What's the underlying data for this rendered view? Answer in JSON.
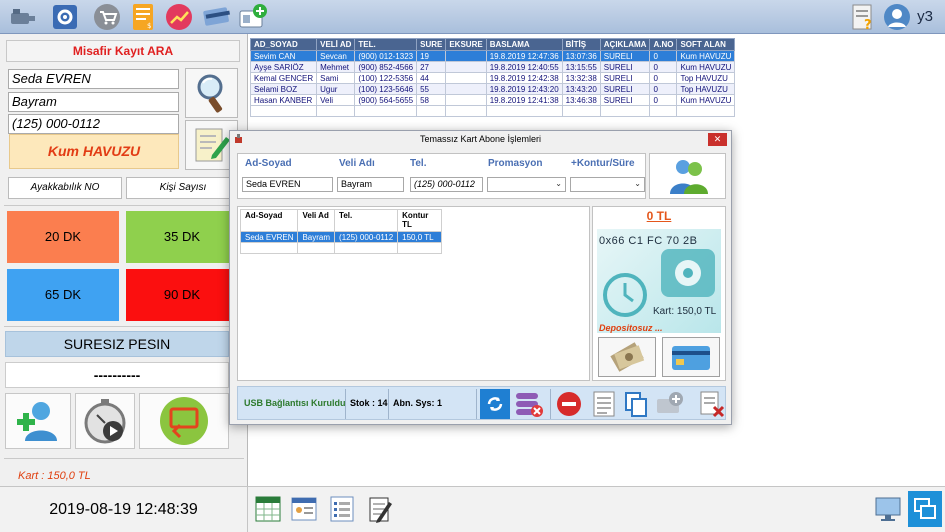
{
  "user": {
    "name": "y3"
  },
  "left_panel": {
    "title": "Misafir Kayıt ARA",
    "name_value": "Seda EVREN",
    "parent_value": "Bayram",
    "phone_value": "(125) 000-0112",
    "pool": "Kum HAVUZU",
    "shoe_no_label": "Ayakkabılık NO",
    "person_count_label": "Kişi Sayısı",
    "durations": [
      "20 DK",
      "35 DK",
      "65 DK",
      "90 DK"
    ],
    "duration_colors": [
      "#fb7e4f",
      "#8fd04d",
      "#3fa2f2",
      "#fb0f0f"
    ],
    "unlimited_label": "SURESIZ PESIN",
    "dashes": "----------",
    "card_balance": "Kart : 150,0 TL"
  },
  "table": {
    "headers": [
      "AD_SOYAD",
      "VELİ AD",
      "TEL.",
      "SURE",
      "EKSURE",
      "BASLAMA",
      "BİTİŞ",
      "AÇIKLAMA",
      "A.NO",
      "SOFT ALAN"
    ],
    "rows": [
      [
        "Sevim CAN",
        "Sevcan",
        "(900) 012-1323",
        "19",
        "",
        "19.8.2019 12:47:36",
        "13:07:36",
        "SURELI",
        "0",
        "Kum HAVUZU"
      ],
      [
        "Ayşe SARIÖZ",
        "Mehmet",
        "(900) 852-4566",
        "27",
        "",
        "19.8.2019 12:40:55",
        "13:15:55",
        "SURELI",
        "0",
        "Kum HAVUZU"
      ],
      [
        "Kemal GENCER",
        "Sami",
        "(100) 122-5356",
        "44",
        "",
        "19.8.2019 12:42:38",
        "13:32:38",
        "SURELI",
        "0",
        "Top HAVUZU"
      ],
      [
        "Selami BOZ",
        "Ugur",
        "(100) 123-5646",
        "55",
        "",
        "19.8.2019 12:43:20",
        "13:43:20",
        "SURELI",
        "0",
        "Top HAVUZU"
      ],
      [
        "Hasan KANBER",
        "Veli",
        "(900) 564-5655",
        "58",
        "",
        "19.8.2019 12:41:38",
        "13:46:38",
        "SURELI",
        "0",
        "Kum HAVUZU"
      ]
    ]
  },
  "modal": {
    "title": "Temassız Kart Abone İşlemleri",
    "close": "✕",
    "labels": {
      "name": "Ad-Soyad",
      "parent": "Veli Adı",
      "phone": "Tel.",
      "promo": "Promasyon",
      "credit": "+Kontur/Süre"
    },
    "values": {
      "name": "Seda EVREN",
      "parent": "Bayram",
      "phone": "(125) 000-0112"
    },
    "list_headers": [
      "Ad-Soyad",
      "Veli Ad",
      "Tel.",
      "Kontur TL"
    ],
    "list_rows": [
      [
        "Seda EVREN",
        "Bayram",
        "(125) 000-0112",
        "150,0 TL"
      ]
    ],
    "balance": "0 TL",
    "card_id": "0x66 C1 FC 70 2B",
    "card_amount": "Kart: 150,0 TL",
    "deposit": "Depositosuz ...",
    "status_usb": "USB Bağlantısı Kuruldu",
    "status_stock": "Stok : 14",
    "status_abn": "Abn. Sys: 1"
  },
  "footer": {
    "datetime": "2019-08-19 12:48:39"
  }
}
